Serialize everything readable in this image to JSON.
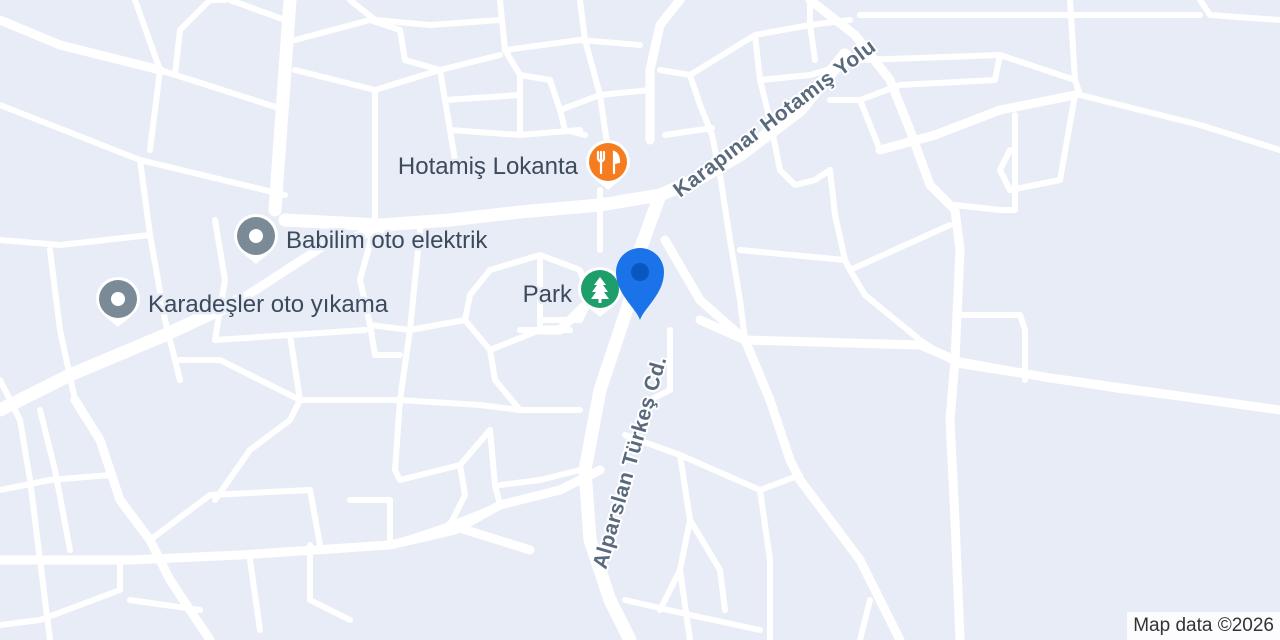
{
  "map": {
    "background_color": "#e8ecf6",
    "road_color": "#ffffff",
    "streets": [
      {
        "name": "Karapınar Hotamış Yolu"
      },
      {
        "name": "Alparslan Türkeş Cd."
      }
    ],
    "places": [
      {
        "name": "Hotamiş Lokanta",
        "icon": "restaurant-icon",
        "color": "#f57c1f"
      },
      {
        "name": "Babilim oto elektrik",
        "icon": "place-pin-icon",
        "color": "#7b8a97"
      },
      {
        "name": "Karadeşler oto yıkama",
        "icon": "place-pin-icon",
        "color": "#7b8a97"
      },
      {
        "name": "Park",
        "icon": "park-tree-icon",
        "color": "#1e9e6a"
      }
    ],
    "current_location_marker": {
      "icon": "location-pin-icon",
      "color": "#1a73e8"
    },
    "attribution": "Map data ©2026"
  }
}
